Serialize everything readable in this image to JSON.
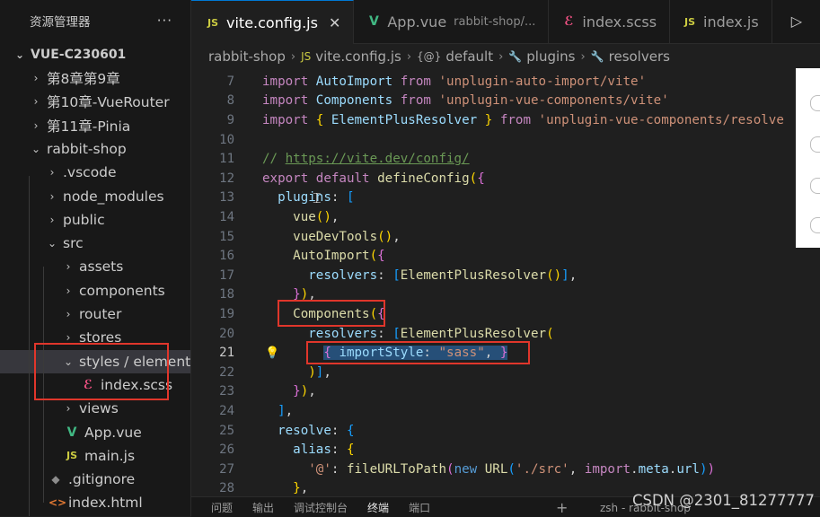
{
  "explorer": {
    "title": "资源管理器",
    "more": "···",
    "root": "VUE-C230601",
    "items": [
      {
        "label": "第8章第9章",
        "chevron": "›",
        "icon": "",
        "icon_type": "none",
        "depth": 1
      },
      {
        "label": "第10章-VueRouter",
        "chevron": "›",
        "icon": "",
        "icon_type": "none",
        "depth": 1
      },
      {
        "label": "第11章-Pinia",
        "chevron": "›",
        "icon": "",
        "icon_type": "none",
        "depth": 1
      },
      {
        "label": "rabbit-shop",
        "chevron": "⌄",
        "icon": "",
        "icon_type": "none",
        "depth": 1
      },
      {
        "label": ".vscode",
        "chevron": "›",
        "icon": "",
        "icon_type": "none",
        "depth": 2
      },
      {
        "label": "node_modules",
        "chevron": "›",
        "icon": "",
        "icon_type": "none",
        "depth": 2
      },
      {
        "label": "public",
        "chevron": "›",
        "icon": "",
        "icon_type": "none",
        "depth": 2
      },
      {
        "label": "src",
        "chevron": "⌄",
        "icon": "",
        "icon_type": "none",
        "depth": 2
      },
      {
        "label": "assets",
        "chevron": "›",
        "icon": "",
        "icon_type": "none",
        "depth": 3
      },
      {
        "label": "components",
        "chevron": "›",
        "icon": "",
        "icon_type": "none",
        "depth": 3
      },
      {
        "label": "router",
        "chevron": "›",
        "icon": "",
        "icon_type": "none",
        "depth": 3
      },
      {
        "label": "stores",
        "chevron": "›",
        "icon": "",
        "icon_type": "none",
        "depth": 3
      },
      {
        "label": "styles / element",
        "chevron": "⌄",
        "icon": "",
        "icon_type": "none",
        "depth": 3,
        "selected": true
      },
      {
        "label": "index.scss",
        "chevron": "",
        "icon": "ℰ",
        "icon_type": "scss",
        "depth": 4
      },
      {
        "label": "views",
        "chevron": "›",
        "icon": "",
        "icon_type": "none",
        "depth": 3
      },
      {
        "label": "App.vue",
        "chevron": "",
        "icon": "V",
        "icon_type": "vue",
        "depth": 3
      },
      {
        "label": "main.js",
        "chevron": "",
        "icon": "JS",
        "icon_type": "js",
        "depth": 3
      },
      {
        "label": ".gitignore",
        "chevron": "",
        "icon": "◆",
        "icon_type": "git",
        "depth": 2
      },
      {
        "label": "index.html",
        "chevron": "",
        "icon": "<>",
        "icon_type": "html",
        "depth": 2
      }
    ]
  },
  "tabs": [
    {
      "icon": "JS",
      "icon_type": "js",
      "label": "vite.config.js",
      "desc": "",
      "close": "✕",
      "active": true
    },
    {
      "icon": "V",
      "icon_type": "vue",
      "label": "App.vue",
      "desc": "rabbit-shop/...",
      "close": "",
      "active": false
    },
    {
      "icon": "ℰ",
      "icon_type": "scss",
      "label": "index.scss",
      "desc": "",
      "close": "",
      "active": false
    },
    {
      "icon": "JS",
      "icon_type": "js",
      "label": "index.js",
      "desc": "",
      "close": "",
      "active": false
    }
  ],
  "run_icon": "▷",
  "breadcrumb": {
    "parts": [
      "rabbit-shop",
      "vite.config.js",
      "default",
      "plugins",
      "resolvers"
    ],
    "icons": [
      "",
      "JS",
      "{@}",
      "🔧",
      "🔧"
    ]
  },
  "editor": {
    "current_line": "21",
    "lightbulb": "💡",
    "lines": [
      {
        "n": "7",
        "tokens": [
          [
            "import ",
            "kw"
          ],
          [
            "AutoImport ",
            "id"
          ],
          [
            "from ",
            "kw"
          ],
          [
            "'unplugin-auto-import/vite'",
            "str"
          ]
        ]
      },
      {
        "n": "8",
        "tokens": [
          [
            "import ",
            "kw"
          ],
          [
            "Components ",
            "id"
          ],
          [
            "from ",
            "kw"
          ],
          [
            "'unplugin-vue-components/vite'",
            "str"
          ]
        ]
      },
      {
        "n": "9",
        "tokens": [
          [
            "import ",
            "kw"
          ],
          [
            "{ ",
            "br1"
          ],
          [
            "ElementPlusResolver ",
            "id"
          ],
          [
            "} ",
            "br1"
          ],
          [
            "from ",
            "kw"
          ],
          [
            "'unplugin-vue-components/resolve",
            "str"
          ]
        ]
      },
      {
        "n": "10",
        "tokens": []
      },
      {
        "n": "11",
        "tokens": [
          [
            "// ",
            "cm"
          ],
          [
            "https://vite.dev/config/",
            "link"
          ]
        ]
      },
      {
        "n": "12",
        "tokens": [
          [
            "export ",
            "kw"
          ],
          [
            "default ",
            "kw"
          ],
          [
            "defineConfig",
            "fn"
          ],
          [
            "(",
            "br1"
          ],
          [
            "{",
            "br2"
          ]
        ]
      },
      {
        "n": "13",
        "tokens": [
          [
            "  ",
            "pu"
          ],
          [
            "plugins",
            "id"
          ],
          [
            ": ",
            "pu"
          ],
          [
            "[",
            "br3"
          ]
        ]
      },
      {
        "n": "14",
        "tokens": [
          [
            "    ",
            "pu"
          ],
          [
            "vue",
            "fn"
          ],
          [
            "()",
            "br1"
          ],
          [
            ",",
            "pu"
          ]
        ]
      },
      {
        "n": "15",
        "tokens": [
          [
            "    ",
            "pu"
          ],
          [
            "vueDevTools",
            "fn"
          ],
          [
            "()",
            "br1"
          ],
          [
            ",",
            "pu"
          ]
        ]
      },
      {
        "n": "16",
        "tokens": [
          [
            "    ",
            "pu"
          ],
          [
            "AutoImport",
            "fn"
          ],
          [
            "(",
            "br1"
          ],
          [
            "{",
            "br2"
          ]
        ]
      },
      {
        "n": "17",
        "tokens": [
          [
            "      ",
            "pu"
          ],
          [
            "resolvers",
            "id"
          ],
          [
            ": ",
            "pu"
          ],
          [
            "[",
            "br3"
          ],
          [
            "ElementPlusResolver",
            "fn"
          ],
          [
            "()",
            "br1"
          ],
          [
            "]",
            "br3"
          ],
          [
            ",",
            "pu"
          ]
        ]
      },
      {
        "n": "18",
        "tokens": [
          [
            "    ",
            "pu"
          ],
          [
            "}",
            "br2"
          ],
          [
            ")",
            "br1"
          ],
          [
            ",",
            "pu"
          ]
        ]
      },
      {
        "n": "19",
        "tokens": [
          [
            "    ",
            "pu"
          ],
          [
            "Components",
            "fn"
          ],
          [
            "(",
            "br1"
          ],
          [
            "{",
            "br2"
          ]
        ]
      },
      {
        "n": "20",
        "tokens": [
          [
            "      ",
            "pu"
          ],
          [
            "resolvers",
            "id"
          ],
          [
            ": ",
            "pu"
          ],
          [
            "[",
            "br3"
          ],
          [
            "ElementPlusResolver",
            "fn"
          ],
          [
            "(",
            "br1"
          ]
        ]
      },
      {
        "n": "21",
        "tokens": [
          [
            "        ",
            "pu"
          ],
          [
            "{ ",
            "br2-sel"
          ],
          [
            "importStyle",
            "id-sel"
          ],
          [
            ": ",
            "pu-sel"
          ],
          [
            "\"sass\"",
            "str-sel"
          ],
          [
            ", ",
            "pu-sel"
          ],
          [
            "}",
            "br2-sel"
          ]
        ]
      },
      {
        "n": "22",
        "tokens": [
          [
            "      ",
            "pu"
          ],
          [
            ")",
            "br1"
          ],
          [
            "]",
            "br3"
          ],
          [
            ",",
            "pu"
          ]
        ]
      },
      {
        "n": "23",
        "tokens": [
          [
            "    ",
            "pu"
          ],
          [
            "}",
            "br2"
          ],
          [
            ")",
            "br1"
          ],
          [
            ",",
            "pu"
          ]
        ]
      },
      {
        "n": "24",
        "tokens": [
          [
            "  ",
            "pu"
          ],
          [
            "]",
            "br3"
          ],
          [
            ",",
            "pu"
          ]
        ]
      },
      {
        "n": "25",
        "tokens": [
          [
            "  ",
            "pu"
          ],
          [
            "resolve",
            "id"
          ],
          [
            ": ",
            "pu"
          ],
          [
            "{",
            "br3"
          ]
        ]
      },
      {
        "n": "26",
        "tokens": [
          [
            "    ",
            "pu"
          ],
          [
            "alias",
            "id"
          ],
          [
            ": ",
            "pu"
          ],
          [
            "{",
            "br1"
          ]
        ]
      },
      {
        "n": "27",
        "tokens": [
          [
            "      ",
            "pu"
          ],
          [
            "'@'",
            "str"
          ],
          [
            ": ",
            "pu"
          ],
          [
            "fileURLToPath",
            "fn"
          ],
          [
            "(",
            "br2"
          ],
          [
            "new ",
            "kw2"
          ],
          [
            "URL",
            "fn"
          ],
          [
            "(",
            "br3"
          ],
          [
            "'./src'",
            "str"
          ],
          [
            ", ",
            "pu"
          ],
          [
            "import",
            "kw"
          ],
          [
            ".",
            "pu"
          ],
          [
            "meta",
            "id"
          ],
          [
            ".",
            "pu"
          ],
          [
            "url",
            "id"
          ],
          [
            ")",
            "br3"
          ],
          [
            ")",
            "br2"
          ]
        ]
      },
      {
        "n": "28",
        "tokens": [
          [
            "    ",
            "pu"
          ],
          [
            "}",
            "br1"
          ],
          [
            ",",
            "pu"
          ]
        ]
      }
    ]
  },
  "bottom_panel": {
    "tabs": [
      "问题",
      "输出",
      "调试控制台",
      "终端",
      "端口"
    ],
    "active": "终端",
    "plus": "+",
    "terminal": "zsh - rabbit-shop"
  },
  "watermark": "CSDN @2301_81277777",
  "colors": {
    "highlight_box": "#e0362b",
    "selection": "#264f78",
    "accent": "#0078d4"
  }
}
